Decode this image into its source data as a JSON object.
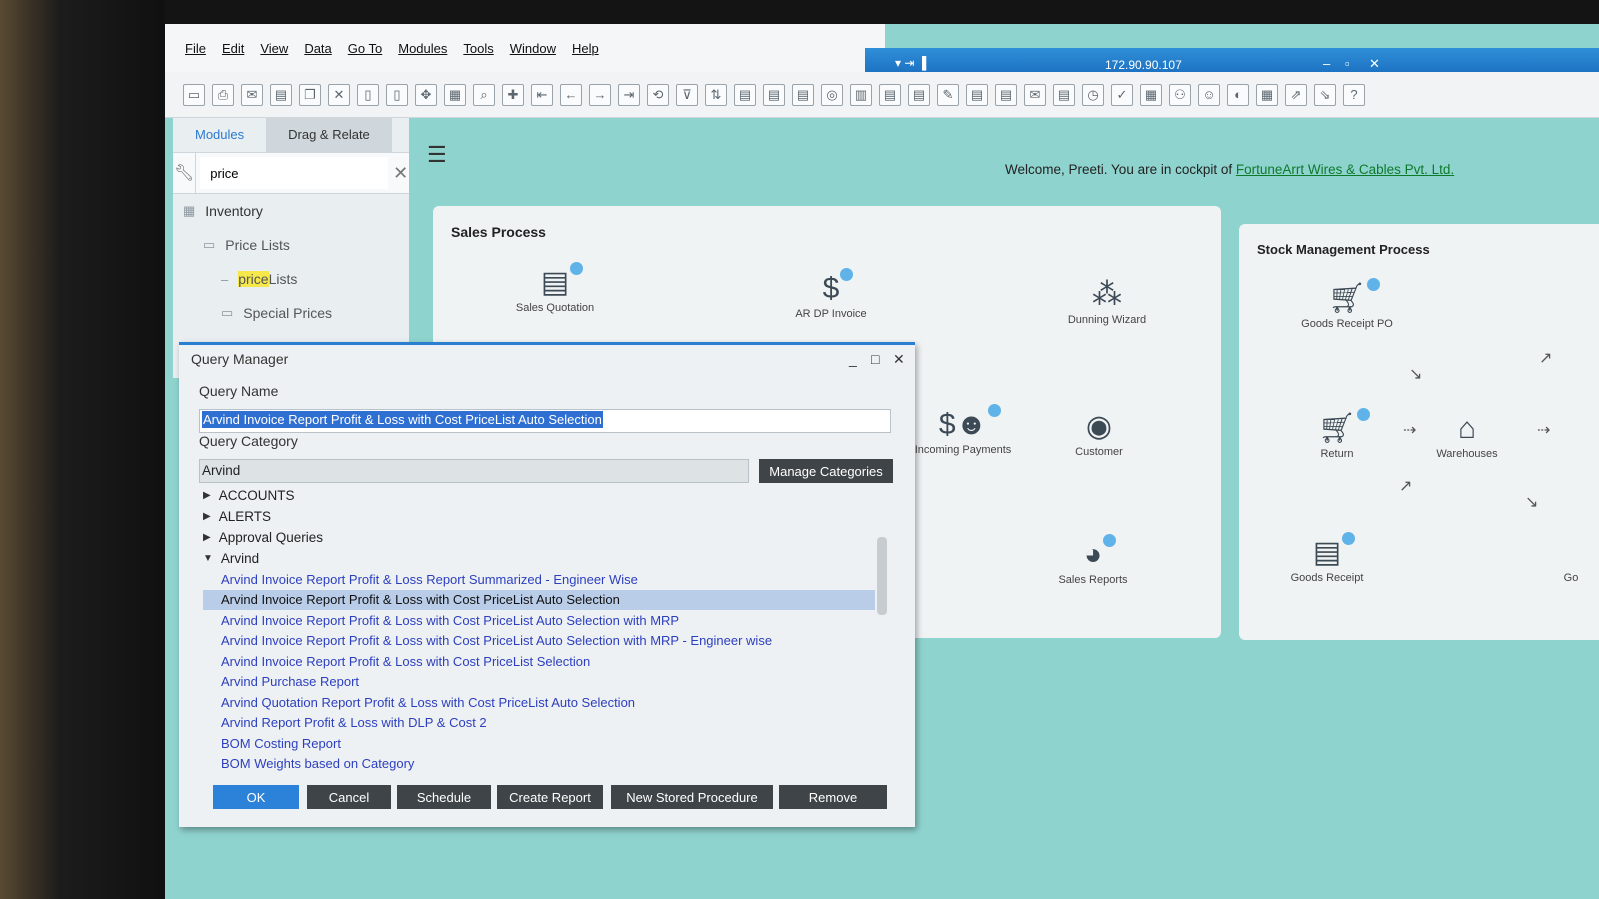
{
  "menu": [
    "File",
    "Edit",
    "View",
    "Data",
    "Go To",
    "Modules",
    "Tools",
    "Window",
    "Help"
  ],
  "titlebar": {
    "ip": "172.90.90.107"
  },
  "side": {
    "tabs": [
      "Modules",
      "Drag & Relate"
    ],
    "search_value": "price",
    "tree": {
      "module": "Inventory",
      "folder1": "Price Lists",
      "item_hl": "price",
      "item_rest": " Lists",
      "folder2": "Special Prices"
    }
  },
  "welcome": {
    "text": "Welcome, Preeti. You are in cockpit of ",
    "company": "FortuneArrt Wires & Cables Pvt. Ltd."
  },
  "sales": {
    "title": "Sales Process",
    "nodes": {
      "quotation": "Sales Quotation",
      "ardp": "AR DP Invoice",
      "dunning": "Dunning Wizard",
      "incoming": "Incoming Payments",
      "customer": "Customer",
      "reports": "Sales Reports"
    }
  },
  "stock": {
    "title": "Stock Management Process",
    "nodes": {
      "grpo": "Goods Receipt PO",
      "return": "Return",
      "warehouses": "Warehouses",
      "receipt": "Goods Receipt",
      "go": "Go"
    }
  },
  "dialog": {
    "title": "Query Manager",
    "query_name_label": "Query Name",
    "query_name": "Arvind Invoice Report Profit & Loss with Cost PriceList Auto Selection",
    "query_category_label": "Query Category",
    "query_category": "Arvind",
    "manage_categories": "Manage Categories",
    "categories": [
      "ACCOUNTS",
      "ALERTS",
      "Approval Queries",
      "Arvind"
    ],
    "items": [
      "Arvind Invoice Report Profit & Loss Report Summarized - Engineer Wise",
      "Arvind Invoice Report Profit & Loss with Cost PriceList Auto Selection",
      "Arvind Invoice Report Profit & Loss with Cost PriceList Auto Selection with MRP",
      "Arvind Invoice Report Profit & Loss with Cost PriceList Auto Selection with MRP - Engineer wise",
      "Arvind Invoice Report Profit & Loss with Cost PriceList Selection",
      "Arvind Purchase Report",
      "Arvind Quotation Report Profit & Loss with Cost PriceList Auto Selection",
      "Arvind Report Profit & Loss with DLP & Cost 2",
      "BOM Costing Report",
      "BOM Weights based on Category"
    ],
    "buttons": {
      "ok": "OK",
      "cancel": "Cancel",
      "schedule": "Schedule",
      "create_report": "Create Report",
      "new_sp": "New Stored Procedure",
      "remove": "Remove"
    }
  }
}
